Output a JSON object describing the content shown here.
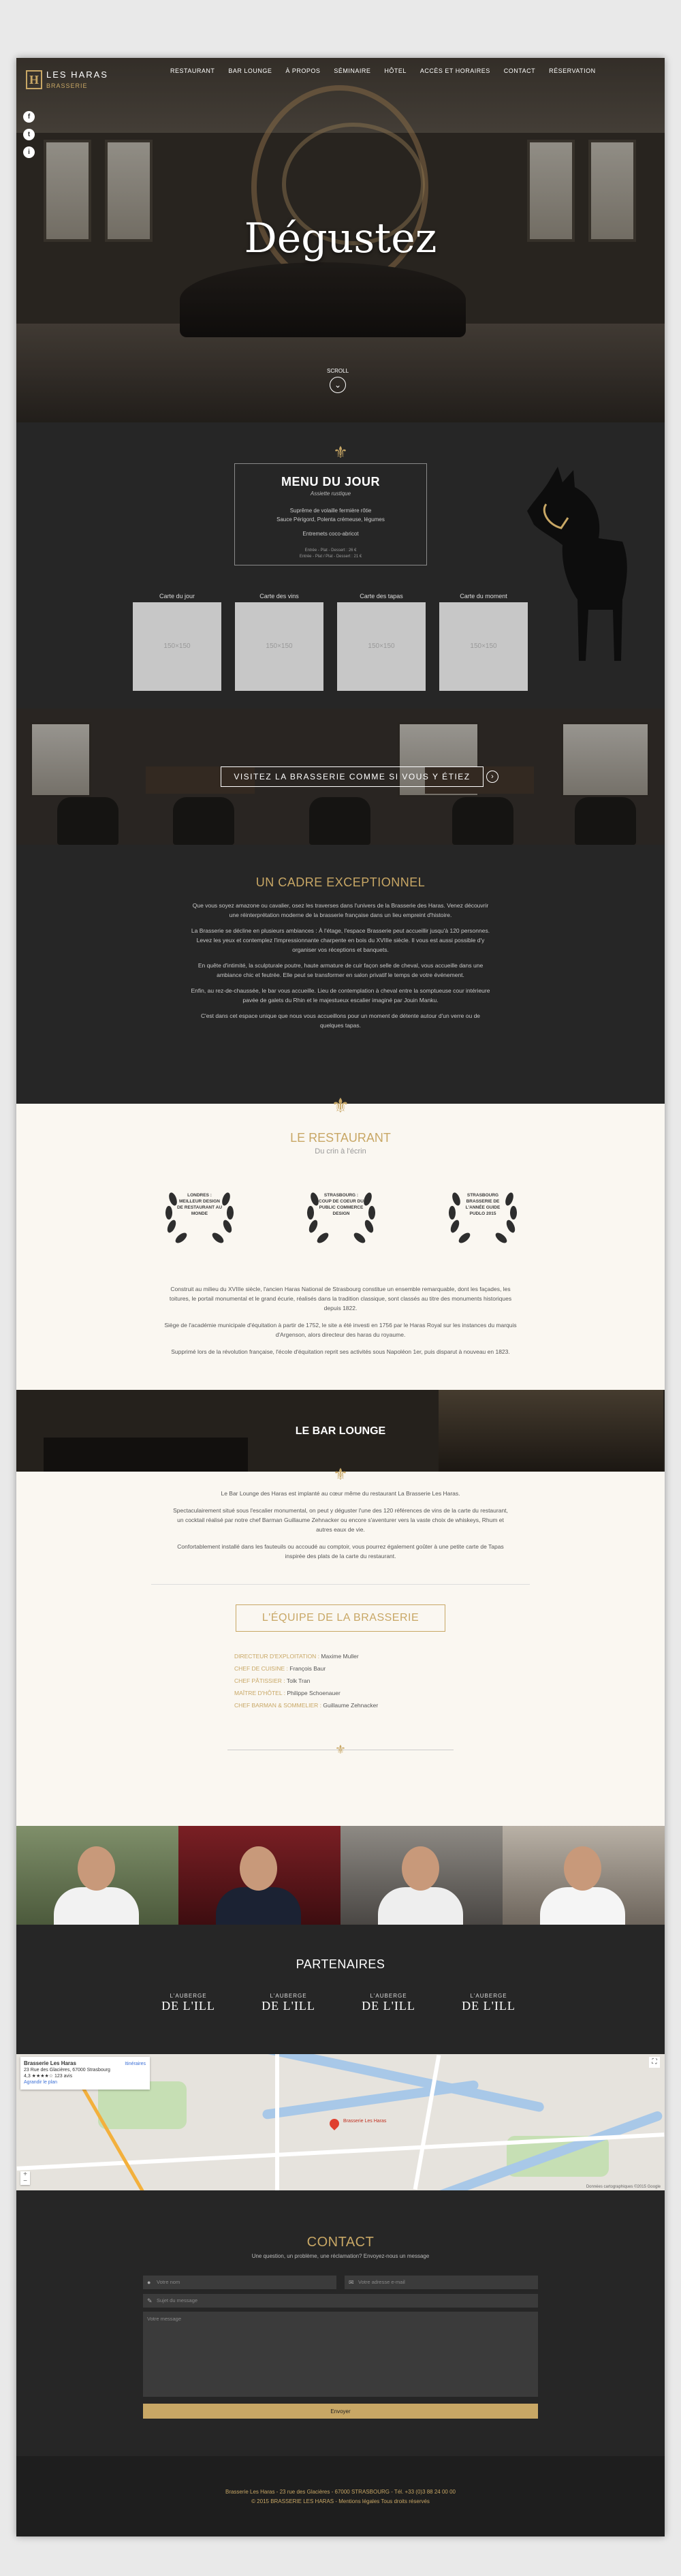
{
  "header": {
    "logo_brand": "LES HARAS",
    "logo_sub": "BRASSERIE",
    "nav": [
      "RESTAURANT",
      "BAR LOUNGE",
      "À PROPOS",
      "SÉMINAIRE",
      "HÔTEL",
      "ACCÈS ET HORAIRES",
      "CONTACT",
      "RÉSERVATION"
    ],
    "social": [
      "f",
      "t",
      "i"
    ]
  },
  "hero": {
    "title": "Dégustez",
    "scroll_label": "SCROLL",
    "scroll_icon": "chevron-down-icon"
  },
  "menu_du_jour": {
    "title": "MENU DU JOUR",
    "subtitle": "Assiette rustique",
    "dish_lines": [
      "Suprême de volaille fermière rôtie",
      "Sauce Périgord, Polenta crémeuse, légumes"
    ],
    "dessert": "Entremets coco-abricot",
    "prices": [
      "Entrée - Plat - Dessert : 26 €",
      "Entrée - Plat / Plat - Dessert : 21 €"
    ],
    "cartes": [
      {
        "label": "Carte du jour",
        "placeholder": "150×150"
      },
      {
        "label": "Carte des vins",
        "placeholder": "150×150"
      },
      {
        "label": "Carte des tapas",
        "placeholder": "150×150"
      },
      {
        "label": "Carte du moment",
        "placeholder": "150×150"
      }
    ]
  },
  "visite": {
    "label": "VISITEZ LA BRASSERIE COMME SI VOUS Y ÉTIEZ",
    "arrow_icon": "arrow-right-icon"
  },
  "cadre": {
    "title": "UN CADRE EXCEPTIONNEL",
    "paragraphs": [
      "Que vous soyez amazone ou cavalier, osez les traverses dans l'univers de la Brasserie des Haras. Venez découvrir une réinterprétation moderne de la brasserie française dans un lieu empreint d'histoire.",
      "La Brasserie se décline en plusieurs ambiances : À l'étage, l'espace Brasserie peut accueillir jusqu'à 120 personnes. Levez les yeux et contemplez l'impressionnante charpente en bois du XVIIIe siècle. Il vous est aussi possible d'y organiser vos réceptions et banquets.",
      "En quête d'intimité, la sculpturale poutre, haute armature de cuir façon selle de cheval, vous accueille dans une ambiance chic et feutrée. Elle peut se transformer en salon privatif le temps de votre événement.",
      "Enfin, au rez-de-chaussée, le bar vous accueille. Lieu de contemplation à cheval entre la somptueuse cour intérieure pavée de galets du Rhin et le majestueux escalier imaginé par Jouin Manku.",
      "C'est dans cet espace unique que nous vous accueillons pour un moment de détente autour d'un verre ou de quelques tapas."
    ]
  },
  "restaurant": {
    "title": "LE RESTAURANT",
    "tagline": "Du crin à l'écrin",
    "awards": [
      "LONDRES : MEILLEUR DESIGN DE RESTAURANT AU MONDE",
      "STRASBOURG : COUP DE COEUR DU PUBLIC COMMERCE DESIGN",
      "STRASBOURG BRASSERIE DE L'ANNÉE GUIDE PUDLO 2015"
    ],
    "paragraphs": [
      "Construit au milieu du XVIIIe siècle, l'ancien Haras National de Strasbourg constitue un ensemble remarquable, dont les façades, les toitures, le portail monumental et le grand écurie, réalisés dans la tradition classique, sont classés au titre des monuments historiques depuis 1822.",
      "Siège de l'académie municipale d'équitation à partir de 1752, le site a été investi en 1756 par le Haras Royal sur les instances du marquis d'Argenson, alors directeur des haras du royaume.",
      "Supprimé lors de la révolution française, l'école d'équitation reprit ses activités sous Napoléon 1er, puis disparut à nouveau en 1823."
    ]
  },
  "bar_lounge": {
    "title": "LE BAR LOUNGE",
    "paragraphs": [
      "Le Bar Lounge des Haras est implanté au cœur même du restaurant La Brasserie Les Haras.",
      "Spectaculairement situé sous l'escalier monumental, on peut y déguster l'une des 120 références de vins de la carte du restaurant, un cocktail réalisé par notre chef Barman Guillaume Zehnacker ou encore s'aventurer vers la vaste choix de whiskeys, Rhum et autres eaux de vie.",
      "Confortablement installé dans les fauteuils ou accoudé au comptoir, vous pourrez également goûter à une petite carte de Tapas inspirée des plats de la carte du restaurant."
    ]
  },
  "equipe": {
    "title": "L'ÉQUIPE DE LA BRASSERIE",
    "members": [
      {
        "role": "DIRECTEUR D'EXPLOITATION :",
        "name": "Maxime Muller"
      },
      {
        "role": "CHEF DE CUISINE :",
        "name": "François Baur"
      },
      {
        "role": "CHEF PÂTISSIER :",
        "name": "Tolk Tran"
      },
      {
        "role": "MAÎTRE D'HÔTEL :",
        "name": "Philippe Schoenauer"
      },
      {
        "role": "CHEF BARMAN & SOMMELIER :",
        "name": "Guillaume Zehnacker"
      }
    ]
  },
  "partenaires": {
    "title": "PARTENAIRES",
    "logos": [
      {
        "line1": "L'AUBERGE",
        "line2": "DE L'ILL"
      },
      {
        "line1": "L'AUBERGE",
        "line2": "DE L'ILL"
      },
      {
        "line1": "L'AUBERGE",
        "line2": "DE L'ILL"
      },
      {
        "line1": "L'AUBERGE",
        "line2": "DE L'ILL"
      }
    ]
  },
  "map": {
    "place": "Brasserie Les Haras",
    "address": "23 Rue des Glacières, 67000 Strasbourg",
    "rating": "4,3 ★★★★☆ 123 avis",
    "link": "Agrandir le plan",
    "directions": "Itinéraires",
    "pin_label": "Brasserie Les Haras",
    "zoom_in": "+",
    "zoom_out": "−",
    "fullscreen": "⛶",
    "attribution": "Données cartographiques ©2015 Google"
  },
  "contact": {
    "title": "CONTACT",
    "intro": "Une question, un problème, une réclamation? Envoyez-nous un message",
    "name_placeholder": "Votre nom",
    "email_placeholder": "Votre adresse e-mail",
    "subject_placeholder": "Sujet du message",
    "message_placeholder": "Votre message",
    "submit": "Envoyer"
  },
  "footer": {
    "line1": "Brasserie Les Haras - 23 rue des Glacières - 67000 STRASBOURG - Tél. +33 (0)3 88 24 00 00",
    "line2": "© 2015 BRASSERIE LES HARAS - Mentions légales Tous droits réservés"
  }
}
